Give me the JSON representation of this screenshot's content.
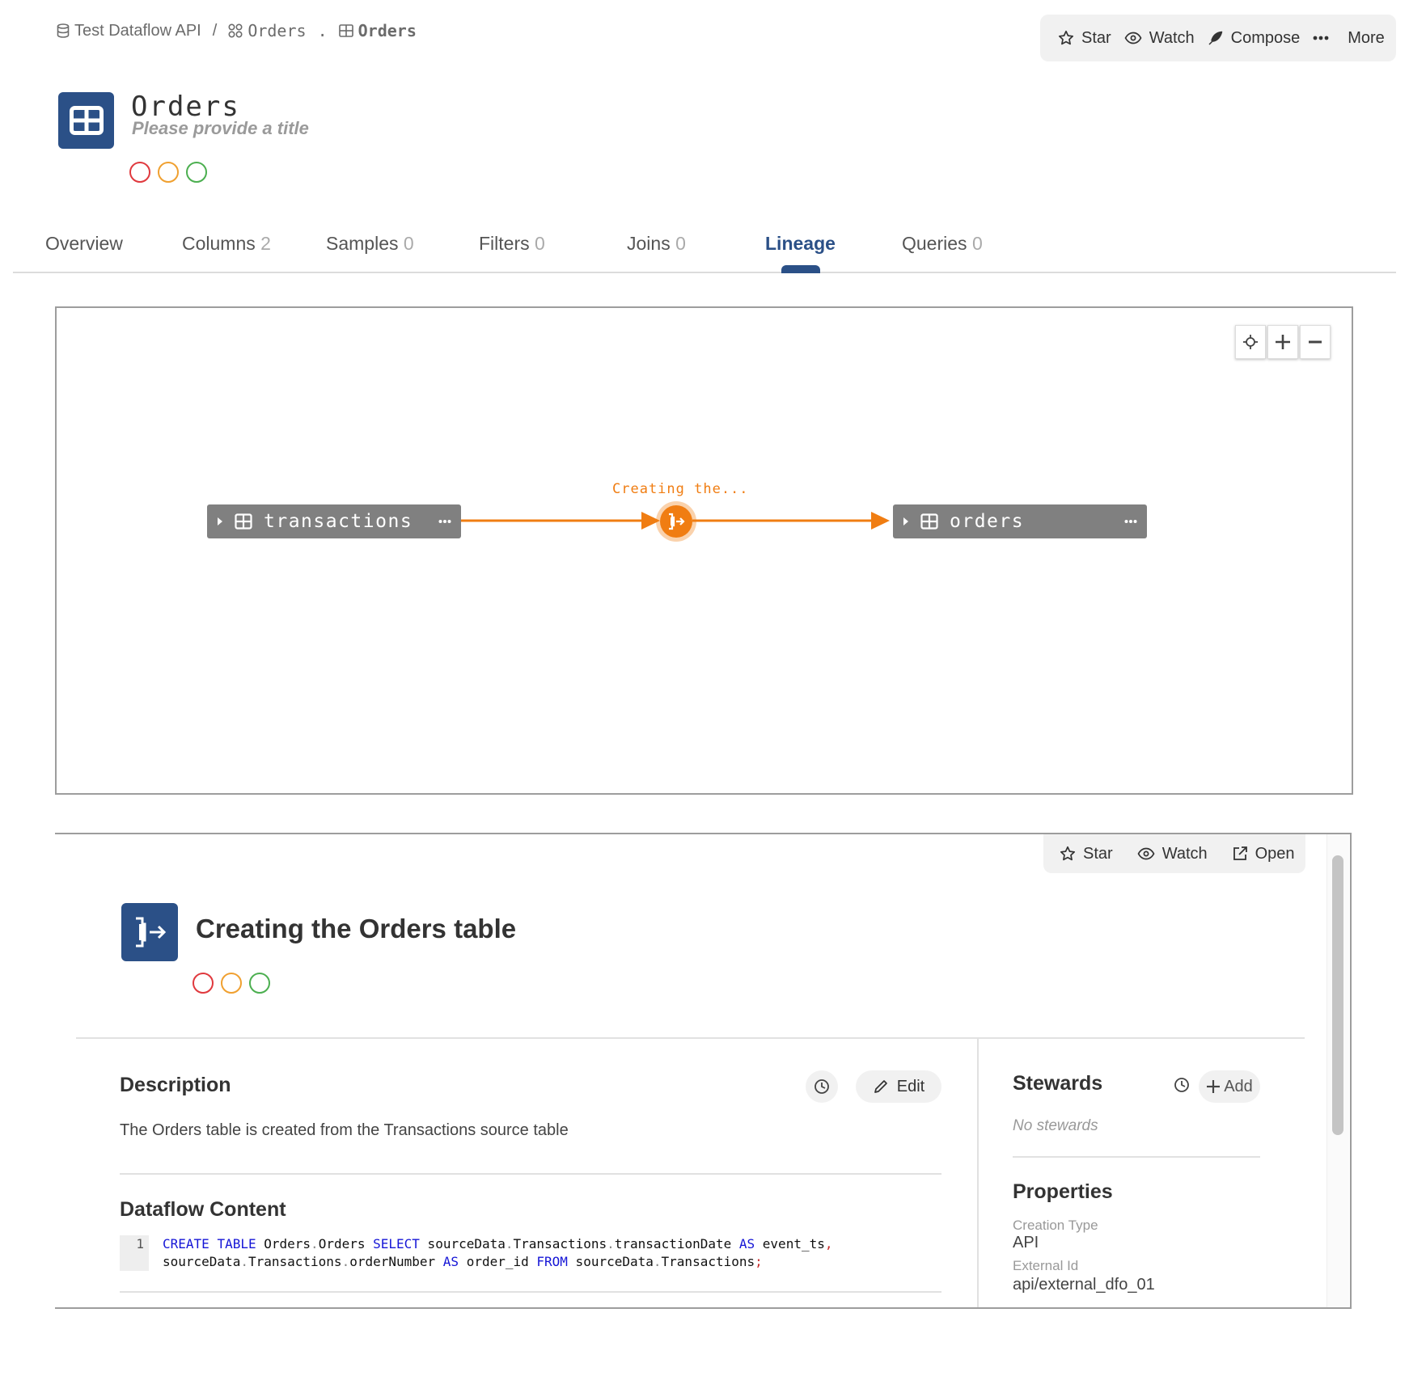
{
  "breadcrumb": {
    "datasource": "Test Dataflow API",
    "separator": "/",
    "schema": "Orders",
    "dot": ".",
    "table": "Orders"
  },
  "top_actions": {
    "star": "Star",
    "watch": "Watch",
    "compose": "Compose",
    "more": "More"
  },
  "entity": {
    "title": "Orders",
    "subtitle": "Please provide a title"
  },
  "tabs": [
    {
      "label": "Overview",
      "count": ""
    },
    {
      "label": "Columns",
      "count": "2"
    },
    {
      "label": "Samples",
      "count": "0"
    },
    {
      "label": "Filters",
      "count": "0"
    },
    {
      "label": "Joins",
      "count": "0"
    },
    {
      "label": "Lineage",
      "count": ""
    },
    {
      "label": "Queries",
      "count": "0"
    }
  ],
  "active_tab": "Lineage",
  "lineage": {
    "source_node": "transactions",
    "target_node": "orders",
    "edge_label": "Creating the..."
  },
  "panel": {
    "actions": {
      "star": "Star",
      "watch": "Watch",
      "open": "Open"
    },
    "title": "Creating the Orders table",
    "description_heading": "Description",
    "edit_label": "Edit",
    "description_text": "The Orders table is created from the Transactions source table",
    "dataflow_heading": "Dataflow Content",
    "code_line_number": "1",
    "stewards_heading": "Stewards",
    "add_label": "Add",
    "no_stewards": "No stewards",
    "properties_heading": "Properties",
    "properties": [
      {
        "label": "Creation Type",
        "value": "API"
      },
      {
        "label": "External Id",
        "value": "api/external_dfo_01"
      }
    ]
  },
  "colors": {
    "brand": "#2b5087",
    "lineage_orange": "#f07d12",
    "node_gray": "#808080",
    "status_red": "#e0393e",
    "status_orange": "#f0a030",
    "status_green": "#4caf50"
  },
  "icons": [
    "database-icon",
    "schema-icon",
    "table-icon",
    "star-icon",
    "eye-icon",
    "feather-icon",
    "more-icon",
    "locate-icon",
    "plus-icon",
    "minus-icon",
    "caret-right-icon",
    "dataflow-icon",
    "external-link-icon",
    "history-icon",
    "pencil-icon"
  ]
}
